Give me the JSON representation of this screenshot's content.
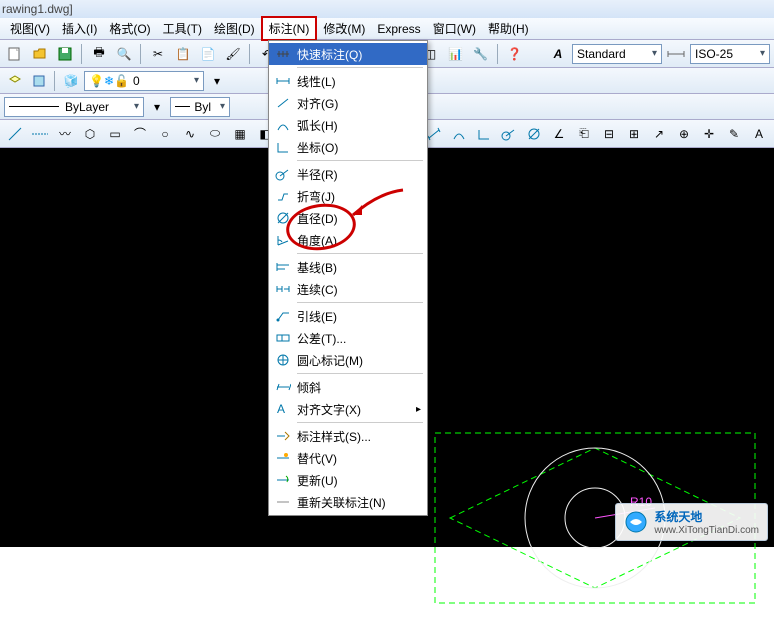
{
  "title": "rawing1.dwg]",
  "menus": [
    "视图(V)",
    "插入(I)",
    "格式(O)",
    "工具(T)",
    "绘图(D)",
    "标注(N)",
    "修改(M)",
    "Express",
    "窗口(W)",
    "帮助(H)"
  ],
  "highlight_menu_index": 5,
  "dimstyle": "ISO-25",
  "textstyle": "Standard",
  "layer": "ByLayer",
  "layer2": "Byl",
  "zero": "0",
  "dropdown_items": [
    {
      "label": "快速标注(Q)",
      "sel": true,
      "icon": "quick"
    },
    {
      "sep": true
    },
    {
      "label": "线性(L)",
      "icon": "linear"
    },
    {
      "label": "对齐(G)",
      "icon": "aligned"
    },
    {
      "label": "弧长(H)",
      "icon": "arc"
    },
    {
      "label": "坐标(O)",
      "icon": "ordinate"
    },
    {
      "sep": true
    },
    {
      "label": "半径(R)",
      "icon": "radius"
    },
    {
      "label": "折弯(J)",
      "icon": "jogged"
    },
    {
      "label": "直径(D)",
      "icon": "diameter",
      "ring": true
    },
    {
      "label": "角度(A)",
      "icon": "angular"
    },
    {
      "sep": true
    },
    {
      "label": "基线(B)",
      "icon": "baseline"
    },
    {
      "label": "连续(C)",
      "icon": "continue"
    },
    {
      "sep": true
    },
    {
      "label": "引线(E)",
      "icon": "leader"
    },
    {
      "label": "公差(T)...",
      "icon": "tolerance"
    },
    {
      "label": "圆心标记(M)",
      "icon": "center"
    },
    {
      "sep": true
    },
    {
      "label": "倾斜",
      "icon": "oblique"
    },
    {
      "label": "对齐文字(X)",
      "icon": "aligntext",
      "arrow": true
    },
    {
      "sep": true
    },
    {
      "label": "标注样式(S)...",
      "icon": "style"
    },
    {
      "label": "替代(V)",
      "icon": "override"
    },
    {
      "label": "更新(U)",
      "icon": "update"
    },
    {
      "label": "重新关联标注(N)",
      "icon": "reassoc"
    }
  ],
  "radius_label": "R10",
  "watermark": {
    "line1": "系统天地",
    "line2": "www.XiTongTianDi.com"
  }
}
